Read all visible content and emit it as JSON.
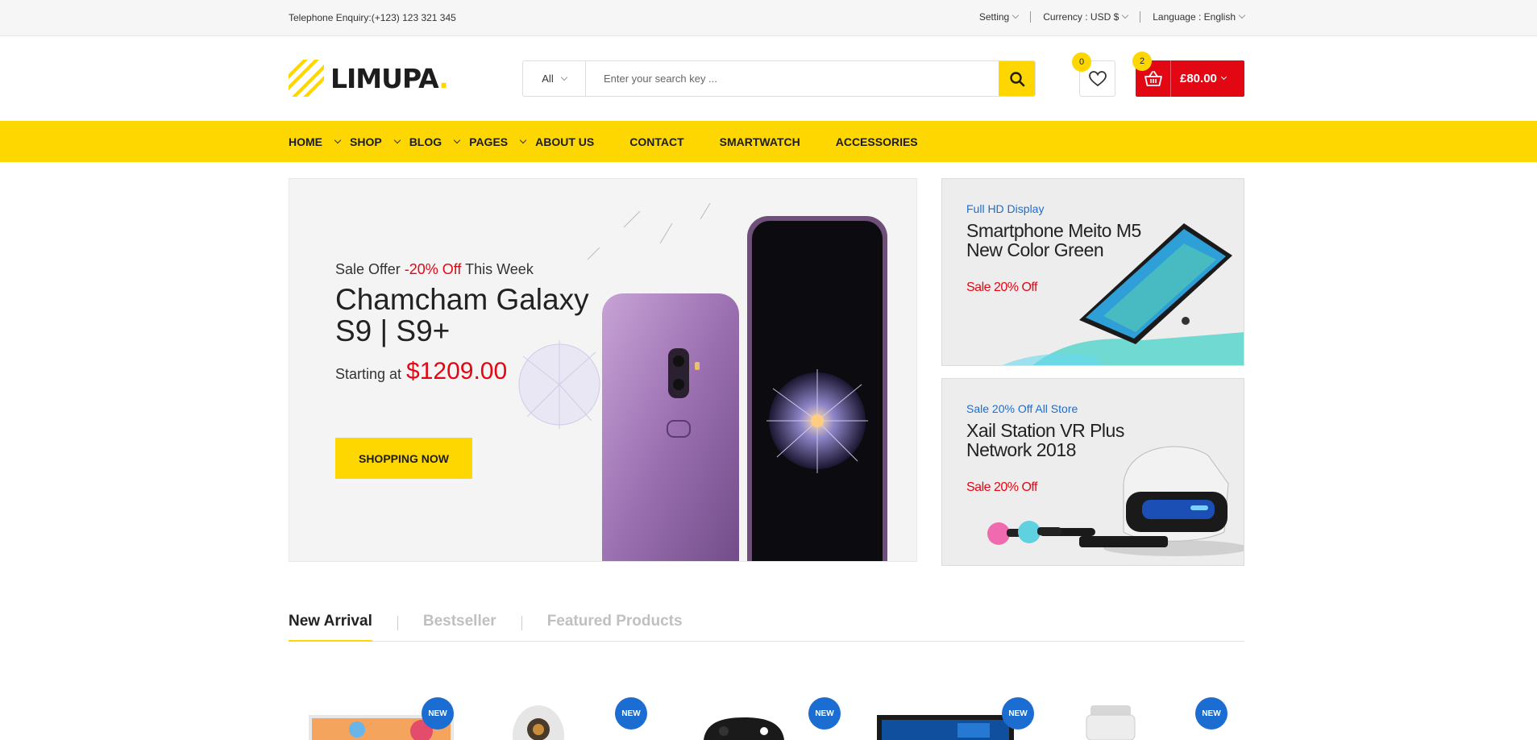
{
  "topbar": {
    "phone": "Telephone Enquiry:(+123) 123 321 345",
    "setting": "Setting",
    "currency": "Currency : USD $",
    "language": "Language : English"
  },
  "logo": {
    "text": "LIMUPA",
    "dot": "."
  },
  "search": {
    "category": "All",
    "placeholder": "Enter your search key ...",
    "button_icon": "search-icon"
  },
  "wishlist": {
    "count": "0",
    "icon": "heart-icon"
  },
  "cart": {
    "count": "2",
    "total": "£80.00",
    "icon": "basket-icon"
  },
  "nav": {
    "items": [
      {
        "label": "HOME",
        "dropdown": true
      },
      {
        "label": "SHOP",
        "dropdown": true
      },
      {
        "label": "BLOG",
        "dropdown": true
      },
      {
        "label": "PAGES",
        "dropdown": true
      },
      {
        "label": "ABOUT US",
        "dropdown": false
      },
      {
        "label": "CONTACT",
        "dropdown": false
      },
      {
        "label": "SMARTWATCH",
        "dropdown": false
      },
      {
        "label": "ACCESSORIES",
        "dropdown": false
      }
    ]
  },
  "hero": {
    "sub_prefix": "Sale Offer",
    "sub_discount": "-20% Off",
    "sub_suffix": "This Week",
    "title": "Chamcham Galaxy S9 | S9+",
    "price_label": "Starting at",
    "price_value": "$1209.00",
    "cta": "SHOPPING NOW"
  },
  "banners": [
    {
      "tag": "Full HD Display",
      "title": "Smartphone Meito M5 New Color Green",
      "offer": "Sale 20% Off"
    },
    {
      "tag": "Sale 20% Off All Store",
      "title": "Xail Station VR Plus Network 2018",
      "offer": "Sale 20% Off"
    }
  ],
  "tabs": [
    {
      "label": "New Arrival",
      "active": true
    },
    {
      "label": "Bestseller",
      "active": false
    },
    {
      "label": "Featured Products",
      "active": false
    }
  ],
  "products": {
    "badge": "NEW",
    "items": [
      "monitor-art",
      "camera-art",
      "gamepad-art",
      "laptop-art",
      "speaker-art"
    ]
  },
  "colors": {
    "accent": "#fed700",
    "red": "#e30613",
    "blue": "#1b6dd1"
  }
}
